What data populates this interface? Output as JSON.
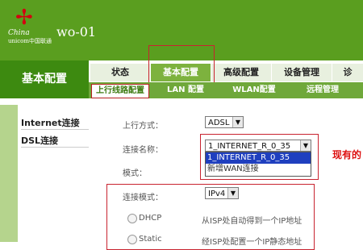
{
  "header": {
    "logo_cn": "China",
    "logo_unicom": "unicom中国联通",
    "device": "wo-01",
    "logo_knot": "✢"
  },
  "side": {
    "title": "基本配置",
    "items": [
      "Internet连接",
      "DSL连接"
    ]
  },
  "tabs": [
    "状态",
    "基本配置",
    "高级配置",
    "设备管理",
    "诊"
  ],
  "subtabs": [
    "上行线路配置",
    "LAN 配置",
    "WLAN配置",
    "远程管理"
  ],
  "form": {
    "uplink_label": "上行方式：",
    "uplink_value": "ADSL",
    "conn_label": "连接名称：",
    "conn_value": "1_INTERNET_R_0_35",
    "conn_options": [
      "1_INTERNET_R_0_35",
      "新增WAN连接"
    ],
    "mode_label": "模式：",
    "conn_mode_label": "连接模式：",
    "conn_mode_value": "IPv4",
    "dhcp_label": "DHCP",
    "dhcp_hint": "从ISP处自动得到一个IP地址",
    "static_label": "Static",
    "static_hint": "经ISP处配置一个IP静态地址"
  },
  "annotation": "现有的"
}
